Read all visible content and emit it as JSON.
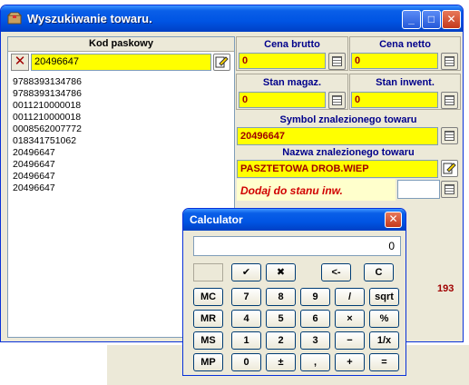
{
  "window": {
    "title": "Wyszukiwanie towaru.",
    "minimize": "_",
    "maximize": "□",
    "close": "✕"
  },
  "barcode": {
    "header": "Kod paskowy",
    "value": "20496647",
    "list": [
      "9788393134786",
      "9788393134786",
      "0011210000018",
      "0011210000018",
      "0008562007772",
      "018341751062",
      "20496647",
      "20496647",
      "20496647",
      "20496647"
    ]
  },
  "fields": {
    "cena_brutto_label": "Cena brutto",
    "cena_brutto": "0",
    "cena_netto_label": "Cena netto",
    "cena_netto": "0",
    "stan_magaz_label": "Stan magaz.",
    "stan_magaz": "0",
    "stan_inwent_label": "Stan inwent.",
    "stan_inwent": "0",
    "symbol_label": "Symbol znalezionego towaru",
    "symbol": "20496647",
    "nazwa_label": "Nazwa znalezionego towaru",
    "nazwa": "PASZTETOWA DROB.WIEP",
    "dodaj_label": "Dodaj do stanu inw.",
    "count": "193"
  },
  "calculator": {
    "title": "Calculator",
    "close": "✕",
    "display": "0",
    "keys_row1": [
      "✔",
      "✖",
      "<-",
      "C"
    ],
    "keys": [
      [
        "MC",
        "7",
        "8",
        "9",
        "/",
        "sqrt"
      ],
      [
        "MR",
        "4",
        "5",
        "6",
        "×",
        "%"
      ],
      [
        "MS",
        "1",
        "2",
        "3",
        "−",
        "1/x"
      ],
      [
        "MP",
        "0",
        "±",
        ",",
        "+",
        "="
      ]
    ]
  },
  "icons": {
    "app": "box-icon",
    "clear": "x-icon",
    "calc": "calculator-icon",
    "edit": "edit-icon"
  }
}
